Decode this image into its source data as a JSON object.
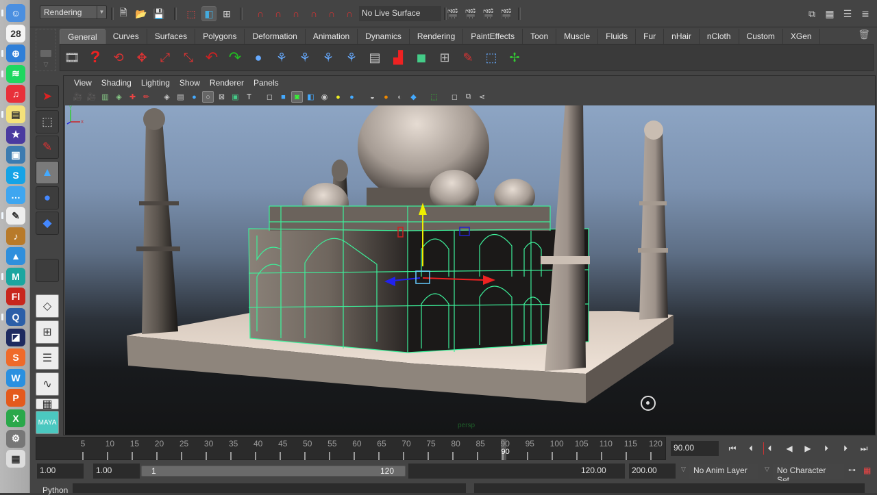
{
  "dock": {
    "items": [
      {
        "name": "finder",
        "glyph": "☺",
        "color": "#4b8fe0",
        "running": true
      },
      {
        "name": "calendar",
        "glyph": "28",
        "color": "#f4f4f4",
        "running": false
      },
      {
        "name": "safari",
        "glyph": "⊕",
        "color": "#2f7fd8",
        "running": true
      },
      {
        "name": "spotify",
        "glyph": "≋",
        "color": "#1ed760",
        "running": true
      },
      {
        "name": "itunes",
        "glyph": "♫",
        "color": "#e8303a",
        "running": false
      },
      {
        "name": "stickies",
        "glyph": "▤",
        "color": "#f5e27a",
        "running": true
      },
      {
        "name": "imovie",
        "glyph": "★",
        "color": "#4a3aa0",
        "running": false
      },
      {
        "name": "iphoto",
        "glyph": "▣",
        "color": "#3c7bb0",
        "running": false
      },
      {
        "name": "skype",
        "glyph": "S",
        "color": "#15a3e6",
        "running": false
      },
      {
        "name": "messages",
        "glyph": "…",
        "color": "#3ea6f0",
        "running": false
      },
      {
        "name": "textedit",
        "glyph": "✎",
        "color": "#eeeeee",
        "running": true
      },
      {
        "name": "garageband",
        "glyph": "♪",
        "color": "#b87a2a",
        "running": false
      },
      {
        "name": "preview",
        "glyph": "▲",
        "color": "#2f8fdc",
        "running": false
      },
      {
        "name": "maya",
        "glyph": "M",
        "color": "#1aa6a0",
        "running": true
      },
      {
        "name": "flash",
        "glyph": "Fl",
        "color": "#c8261d",
        "running": false
      },
      {
        "name": "quicktime",
        "glyph": "Q",
        "color": "#2c5fa8",
        "running": true
      },
      {
        "name": "media-encoder",
        "glyph": "◪",
        "color": "#1e2a60",
        "running": false
      },
      {
        "name": "app-s",
        "glyph": "S",
        "color": "#ef6a2a",
        "running": false
      },
      {
        "name": "word",
        "glyph": "W",
        "color": "#2a90e0",
        "running": false
      },
      {
        "name": "powerpoint",
        "glyph": "P",
        "color": "#e45a1c",
        "running": false
      },
      {
        "name": "excel",
        "glyph": "X",
        "color": "#2aa84a",
        "running": false
      },
      {
        "name": "system-preferences",
        "glyph": "⚙",
        "color": "#777777",
        "running": false
      },
      {
        "name": "document-stack",
        "glyph": "▦",
        "color": "#dddddd",
        "running": false
      }
    ]
  },
  "statusline": {
    "menu_set": "Rendering",
    "live_surface": "No Live Surface"
  },
  "shelf": {
    "tabs": [
      "General",
      "Curves",
      "Surfaces",
      "Polygons",
      "Deformation",
      "Animation",
      "Dynamics",
      "Rendering",
      "PaintEffects",
      "Toon",
      "Muscle",
      "Fluids",
      "Fur",
      "nHair",
      "nCloth",
      "Custom",
      "XGen"
    ],
    "active_tab": "General"
  },
  "panel": {
    "menus": [
      "View",
      "Shading",
      "Lighting",
      "Show",
      "Renderer",
      "Panels"
    ],
    "camera": "persp"
  },
  "timeslider": {
    "ticks": [
      5,
      10,
      15,
      20,
      25,
      30,
      35,
      40,
      45,
      50,
      55,
      60,
      65,
      70,
      75,
      80,
      85,
      90,
      95,
      100,
      105,
      110,
      115,
      120
    ],
    "current_frame": 90,
    "current_frame_label": "90",
    "current_time": "90.00",
    "min": 1,
    "max": 120
  },
  "rangeslider": {
    "start_time": "1.00",
    "playback_start": "1.00",
    "range_low": "1",
    "range_high": "120",
    "playback_end": "120.00",
    "end_time": "200.00",
    "anim_layer": "No Anim Layer",
    "character_set": "No Character Set"
  },
  "cmdline": {
    "label": "Python"
  },
  "colors": {
    "wireframe": "#3df09a",
    "accent_red": "#cc2222"
  }
}
